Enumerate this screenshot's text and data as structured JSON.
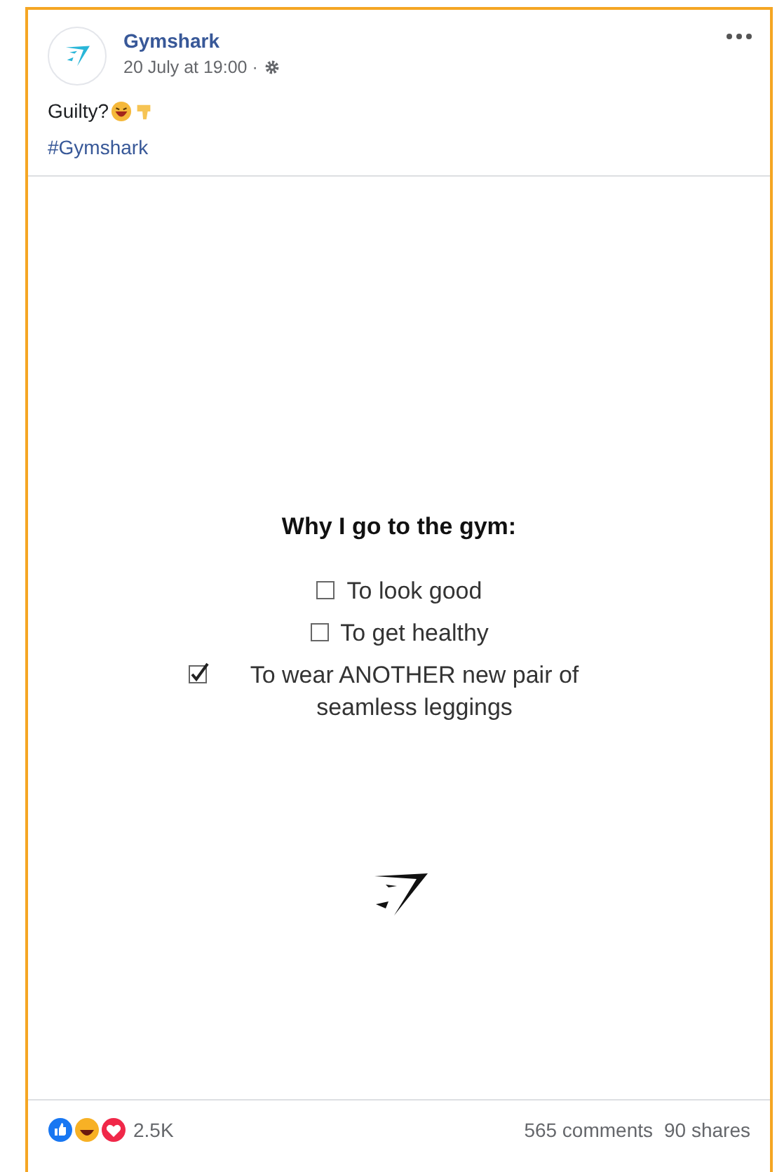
{
  "post": {
    "author": "Gymshark",
    "timestamp": "20 July at 19:00 ·",
    "caption": "Guilty?",
    "hashtag": "#Gymshark"
  },
  "image": {
    "heading": "Why I go to the gym:",
    "checklist": [
      {
        "label": "To look good",
        "checked": false
      },
      {
        "label": "To get healthy",
        "checked": false
      },
      {
        "label": "To wear ANOTHER new pair of seamless leggings",
        "checked": true
      }
    ]
  },
  "footer": {
    "reaction_count": "2.5K",
    "comments": "565 comments",
    "shares": "90 shares"
  }
}
